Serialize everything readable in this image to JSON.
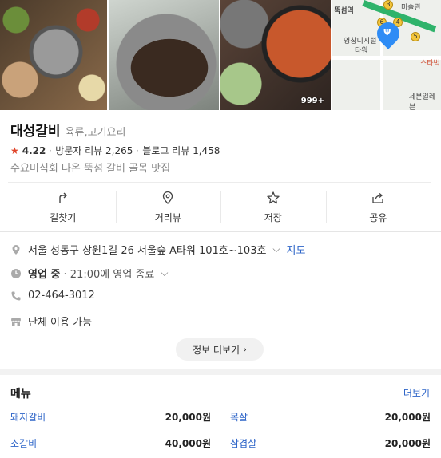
{
  "photos": {
    "count_badge": "999+"
  },
  "map": {
    "labels": [
      "뚝섬역",
      "미술관",
      "영창디지털",
      "타워",
      "스타벅",
      "세븐일레븐"
    ],
    "route_numbers": [
      "3",
      "6",
      "4",
      "5"
    ]
  },
  "place": {
    "name": "대성갈비",
    "category": "육류,고기요리",
    "rating": "4.22",
    "visitor_review_label": "방문자 리뷰",
    "visitor_review_count": "2,265",
    "blog_review_label": "블로그 리뷰",
    "blog_review_count": "1,458",
    "description": "수요미식회 나온 뚝섬 갈비 골목 맛집"
  },
  "actions": [
    {
      "label": "길찾기",
      "icon": "directions-icon"
    },
    {
      "label": "거리뷰",
      "icon": "location-pin-icon"
    },
    {
      "label": "저장",
      "icon": "star-icon"
    },
    {
      "label": "공유",
      "icon": "share-icon"
    }
  ],
  "info": {
    "address": "서울 성동구 상원1길 26 서울숲 A타워 101호~103호",
    "map_link": "지도",
    "status": "영업 중",
    "hours": "· 21:00에 영업 종료",
    "phone": "02-464-3012",
    "group": "단체 이용 가능",
    "more_button": "정보 더보기"
  },
  "menu": {
    "title": "메뉴",
    "more_link": "더보기",
    "items": [
      {
        "name": "돼지갈비",
        "price": "20,000원"
      },
      {
        "name": "목살",
        "price": "20,000원"
      },
      {
        "name": "소갈비",
        "price": "40,000원"
      },
      {
        "name": "삼겹살",
        "price": "20,000원"
      }
    ]
  },
  "colors": {
    "accent": "#2e65c8",
    "star": "#e0452b",
    "map_pin": "#2e8cf5"
  }
}
